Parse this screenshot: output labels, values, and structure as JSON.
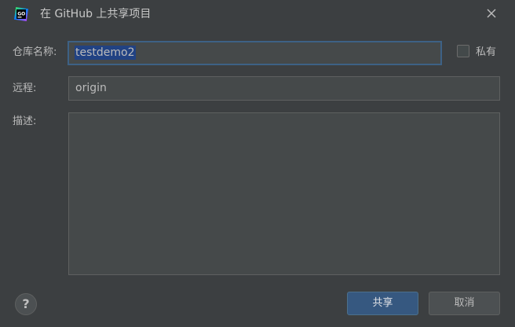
{
  "window": {
    "title": "在 GitHub 上共享项目",
    "app_icon": "goland-icon",
    "close_icon": "close-icon"
  },
  "form": {
    "repo_name_label": "仓库名称:",
    "repo_name_value": "testdemo2",
    "private_label": "私有",
    "private_checked": false,
    "remote_label": "远程:",
    "remote_value": "origin",
    "description_label": "描述:",
    "description_value": ""
  },
  "buttons": {
    "help_label": "?",
    "share_label": "共享",
    "cancel_label": "取消"
  },
  "colors": {
    "background": "#3c3f41",
    "field": "#45494a",
    "focus_border": "#3d6185",
    "selection": "#214283",
    "primary_button": "#365880"
  }
}
